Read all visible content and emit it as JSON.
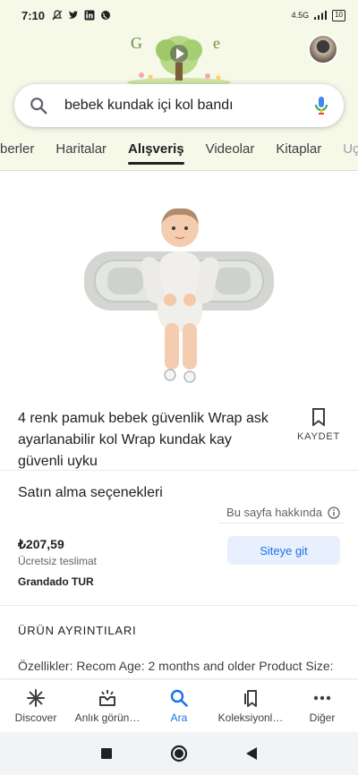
{
  "status": {
    "time": "7:10",
    "battery": "10",
    "network": "4.5G"
  },
  "search": {
    "query": "bebek kundak içi kol bandı"
  },
  "tabs": [
    {
      "label": "berler"
    },
    {
      "label": "Haritalar"
    },
    {
      "label": "Alışveriş"
    },
    {
      "label": "Videolar"
    },
    {
      "label": "Kitaplar"
    },
    {
      "label": "Uç"
    }
  ],
  "product": {
    "title": "4 renk pamuk bebek güvenlik Wrap ask ayarlanabilir kol Wrap kundak kay güvenli uyku",
    "save_label": "KAYDET"
  },
  "purchase": {
    "section_title": "Satın alma seçenekleri",
    "about_label": "Bu sayfa hakkında",
    "price": "₺207,59",
    "shipping": "Ücretsiz teslimat",
    "seller": "Grandado TUR",
    "visit_label": "Siteye git"
  },
  "details": {
    "heading": "ÜRÜN AYRINTILARI",
    "text": "Özellikler: Recom Age: 2 months and older Product Size:"
  },
  "bottom_nav": [
    {
      "label": "Discover",
      "icon": "asterisk-icon"
    },
    {
      "label": "Anlık görün…",
      "icon": "inbox-icon"
    },
    {
      "label": "Ara",
      "icon": "search-icon"
    },
    {
      "label": "Koleksiyonl…",
      "icon": "collections-icon"
    },
    {
      "label": "Diğer",
      "icon": "more-icon"
    }
  ],
  "colors": {
    "accent": "#1a73e8",
    "header_bg": "#f6f8e8"
  }
}
